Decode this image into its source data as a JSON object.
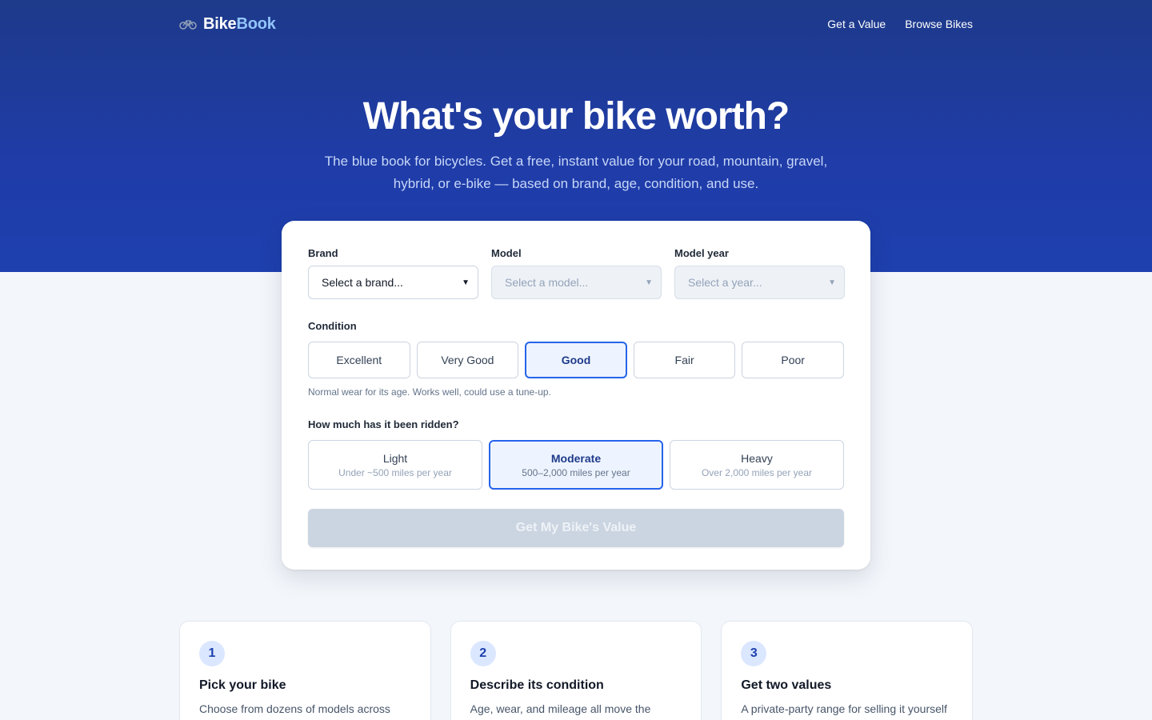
{
  "brand": {
    "name_main": "Bike",
    "name_accent": "Book"
  },
  "nav": {
    "links": [
      "Get a Value",
      "Browse Bikes"
    ]
  },
  "hero": {
    "title": "What's your bike worth?",
    "subtitle": "The blue book for bicycles. Get a free, instant value for your road, mountain, gravel, hybrid, or e-bike — based on brand, age, condition, and use."
  },
  "form": {
    "brand": {
      "label": "Brand",
      "value": "Select a brand..."
    },
    "model": {
      "label": "Model",
      "value": "Select a model..."
    },
    "year": {
      "label": "Model year",
      "value": "Select a year..."
    },
    "condition": {
      "label": "Condition",
      "options": [
        "Excellent",
        "Very Good",
        "Good",
        "Fair",
        "Poor"
      ],
      "selected": "Good",
      "help": "Normal wear for its age. Works well, could use a tune-up."
    },
    "usage": {
      "label": "How much has it been ridden?",
      "options": [
        {
          "title": "Light",
          "sub": "Under ~500 miles per year"
        },
        {
          "title": "Moderate",
          "sub": "500–2,000 miles per year"
        },
        {
          "title": "Heavy",
          "sub": "Over 2,000 miles per year"
        }
      ],
      "selected": "Moderate"
    },
    "submit_label": "Get My Bike's Value"
  },
  "steps": [
    {
      "num": "1",
      "title": "Pick your bike",
      "desc": "Choose from dozens of models across major brands — Trek, Specialized, Cannondale"
    },
    {
      "num": "2",
      "title": "Describe its condition",
      "desc": "Age, wear, and mileage all move the needle. Be honest and we will estimate"
    },
    {
      "num": "3",
      "title": "Get two values",
      "desc": "A private-party range for selling it yourself and a trade-in value for what"
    }
  ],
  "colors": {
    "hero_bg": "#1e3a8a",
    "accent": "#2563eb",
    "logo_accent": "#93c5fd"
  }
}
